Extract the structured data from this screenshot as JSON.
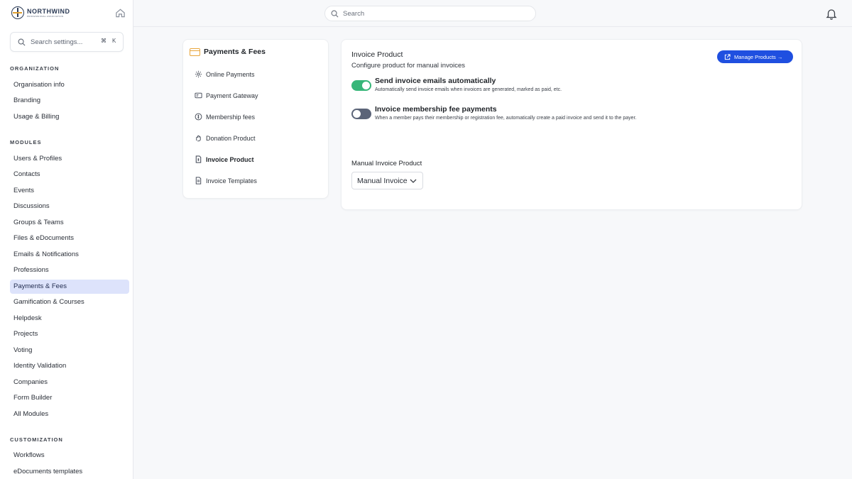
{
  "brand": {
    "name": "NORTHWIND",
    "tagline": "PROFESSIONAL ASSOCIATION"
  },
  "settings_search": {
    "placeholder": "Search settings...",
    "shortcut_cmd": "⌘",
    "shortcut_key": "K"
  },
  "top_search": {
    "placeholder": "Search"
  },
  "sidebar": {
    "organization_label": "ORGANIZATION",
    "organization_items": [
      "Organisation info",
      "Branding",
      "Usage & Billing"
    ],
    "modules_label": "MODULES",
    "modules_items": [
      "Users & Profiles",
      "Contacts",
      "Events",
      "Discussions",
      "Groups & Teams",
      "Files & eDocuments",
      "Emails & Notifications",
      "Professions",
      "Payments & Fees",
      "Gamification & Courses",
      "Helpdesk",
      "Projects",
      "Voting",
      "Identity Validation",
      "Companies",
      "Form Builder",
      "All Modules"
    ],
    "active_item": "Payments & Fees",
    "customization_label": "CUSTOMIZATION",
    "customization_items": [
      "Workflows",
      "eDocuments templates"
    ]
  },
  "submenu": {
    "title": "Payments & Fees",
    "items": [
      {
        "label": "Online Payments",
        "icon": "gear-icon"
      },
      {
        "label": "Payment Gateway",
        "icon": "gateway-icon"
      },
      {
        "label": "Membership fees",
        "icon": "coin-icon"
      },
      {
        "label": "Donation Product",
        "icon": "hand-icon"
      },
      {
        "label": "Invoice Product",
        "icon": "invoice-icon",
        "active": true
      },
      {
        "label": "Invoice Templates",
        "icon": "document-icon"
      }
    ]
  },
  "panel": {
    "title": "Invoice Product",
    "subtitle": "Configure product for manual invoices",
    "manage_button": "Manage Products →",
    "options": [
      {
        "title": "Send invoice emails automatically",
        "description": "Automatically send invoice emails when invoices are generated, marked as paid, etc.",
        "enabled": true
      },
      {
        "title": "Invoice membership fee payments",
        "description": "When a member pays their membership or registration fee, automatically create a paid invoice and send it to the payer.",
        "enabled": false
      }
    ],
    "field_label": "Manual Invoice Product",
    "field_value": "Manual Invoice"
  },
  "colors": {
    "accent": "#1f4fe0",
    "toggle_on": "#37b679",
    "toggle_off": "#5b6478",
    "active_nav": "#dde3fb"
  }
}
